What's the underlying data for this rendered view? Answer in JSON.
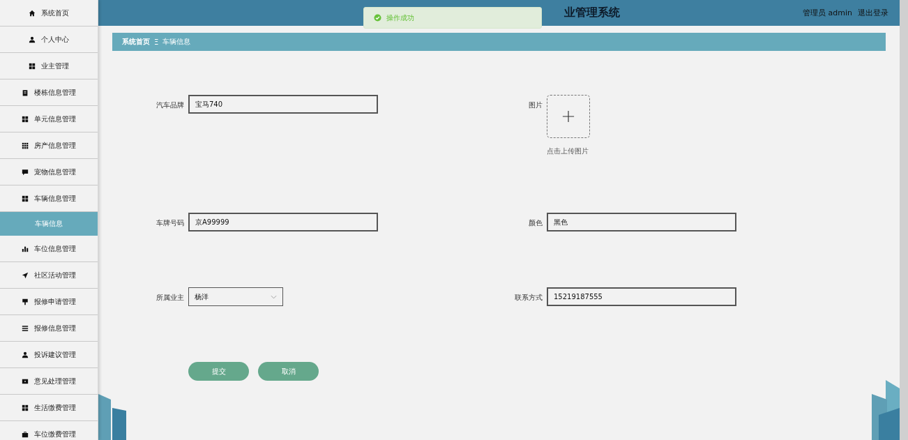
{
  "sidebar": {
    "items": [
      {
        "label": "系统首页",
        "kind": "home",
        "selected": false
      },
      {
        "label": "个人中心",
        "kind": "user",
        "selected": false
      },
      {
        "label": "业主管理",
        "kind": "grid",
        "selected": false
      },
      {
        "label": "楼栋信息管理",
        "kind": "clipboard",
        "selected": false
      },
      {
        "label": "单元信息管理",
        "kind": "grid",
        "selected": false
      },
      {
        "label": "房产信息管理",
        "kind": "grid9",
        "selected": false
      },
      {
        "label": "宠物信息管理",
        "kind": "chat",
        "selected": false
      },
      {
        "label": "车辆信息管理",
        "kind": "grid",
        "selected": false,
        "children": [
          {
            "label": "车辆信息",
            "selected": true
          }
        ]
      },
      {
        "label": "车位信息管理",
        "kind": "bars",
        "selected": false
      },
      {
        "label": "社区活动管理",
        "kind": "plane",
        "selected": false
      },
      {
        "label": "报修申请管理",
        "kind": "brush",
        "selected": false
      },
      {
        "label": "报修信息管理",
        "kind": "list",
        "selected": false
      },
      {
        "label": "投诉建议管理",
        "kind": "user",
        "selected": false
      },
      {
        "label": "意见处理管理",
        "kind": "card",
        "selected": false
      },
      {
        "label": "生活缴费管理",
        "kind": "grid",
        "selected": false
      },
      {
        "label": "车位缴费管理",
        "kind": "case",
        "selected": false
      }
    ]
  },
  "header": {
    "title": "业管理系统",
    "user": "管理员 admin",
    "logout": "退出登录"
  },
  "toast": {
    "message": "操作成功"
  },
  "breadcrumb": {
    "items": [
      "系统首页",
      "车辆信息"
    ],
    "separator": "Ξ"
  },
  "form": {
    "fields": [
      {
        "kind": "text",
        "label": "汽车品牌",
        "value": "宝马740"
      },
      {
        "kind": "upload",
        "label": "图片",
        "hint": "点击上传图片"
      },
      {
        "kind": "text",
        "label": "车牌号码",
        "value": "京A99999"
      },
      {
        "kind": "text",
        "label": "颜色",
        "value": "黑色"
      },
      {
        "kind": "select",
        "label": "所属业主",
        "value": "杨洋"
      },
      {
        "kind": "text",
        "label": "联系方式",
        "value": "15219187555"
      }
    ],
    "buttons": [
      "提交",
      "取消"
    ]
  }
}
